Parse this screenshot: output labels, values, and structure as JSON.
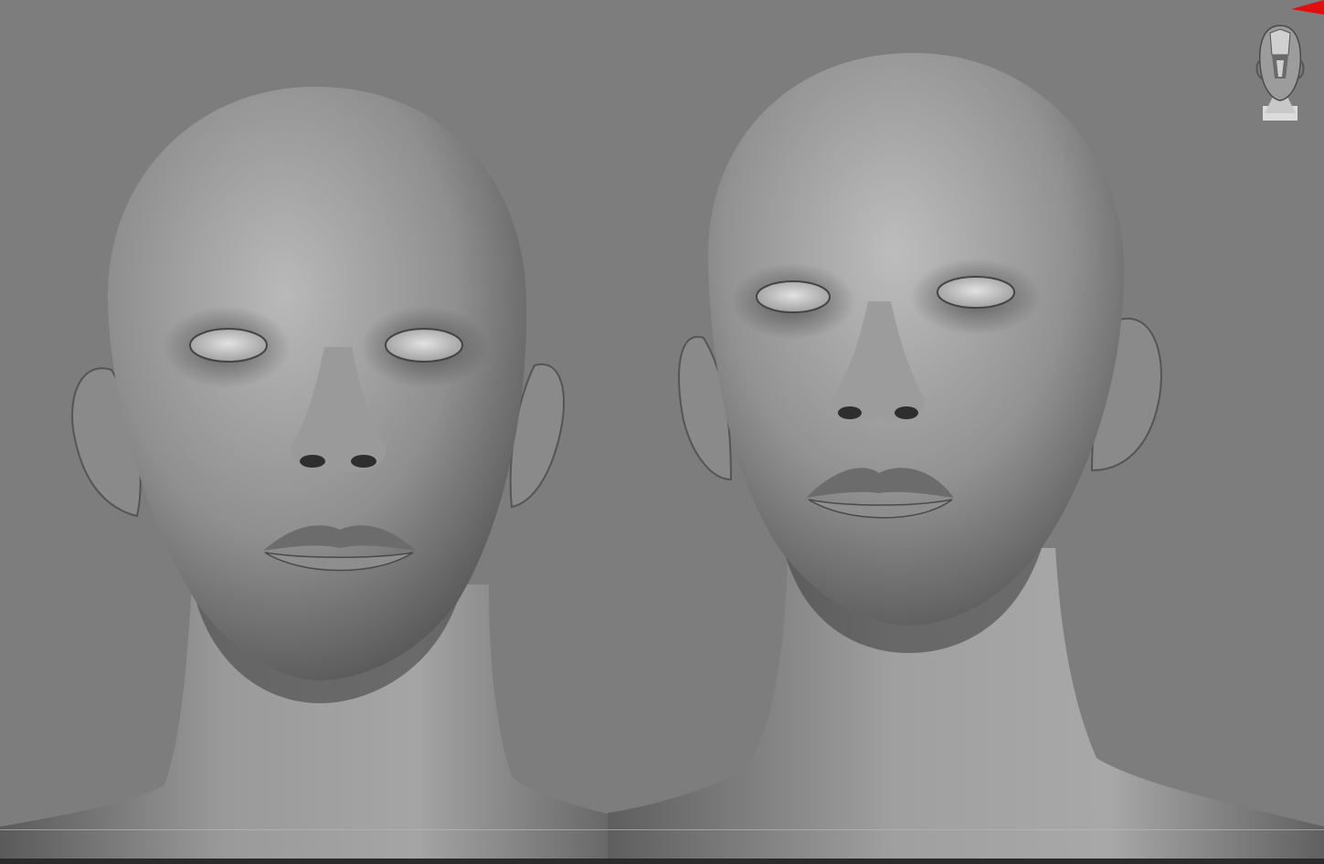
{
  "viewport": {
    "background": "#7d7d7d",
    "models": [
      {
        "name": "head-sculpt-front"
      },
      {
        "name": "head-sculpt-three-quarter"
      }
    ],
    "nav_cube": {
      "icon": "head-navigation-cube-icon"
    },
    "indicator": {
      "icon": "red-pin-indicator-icon",
      "color": "#e01010"
    }
  }
}
